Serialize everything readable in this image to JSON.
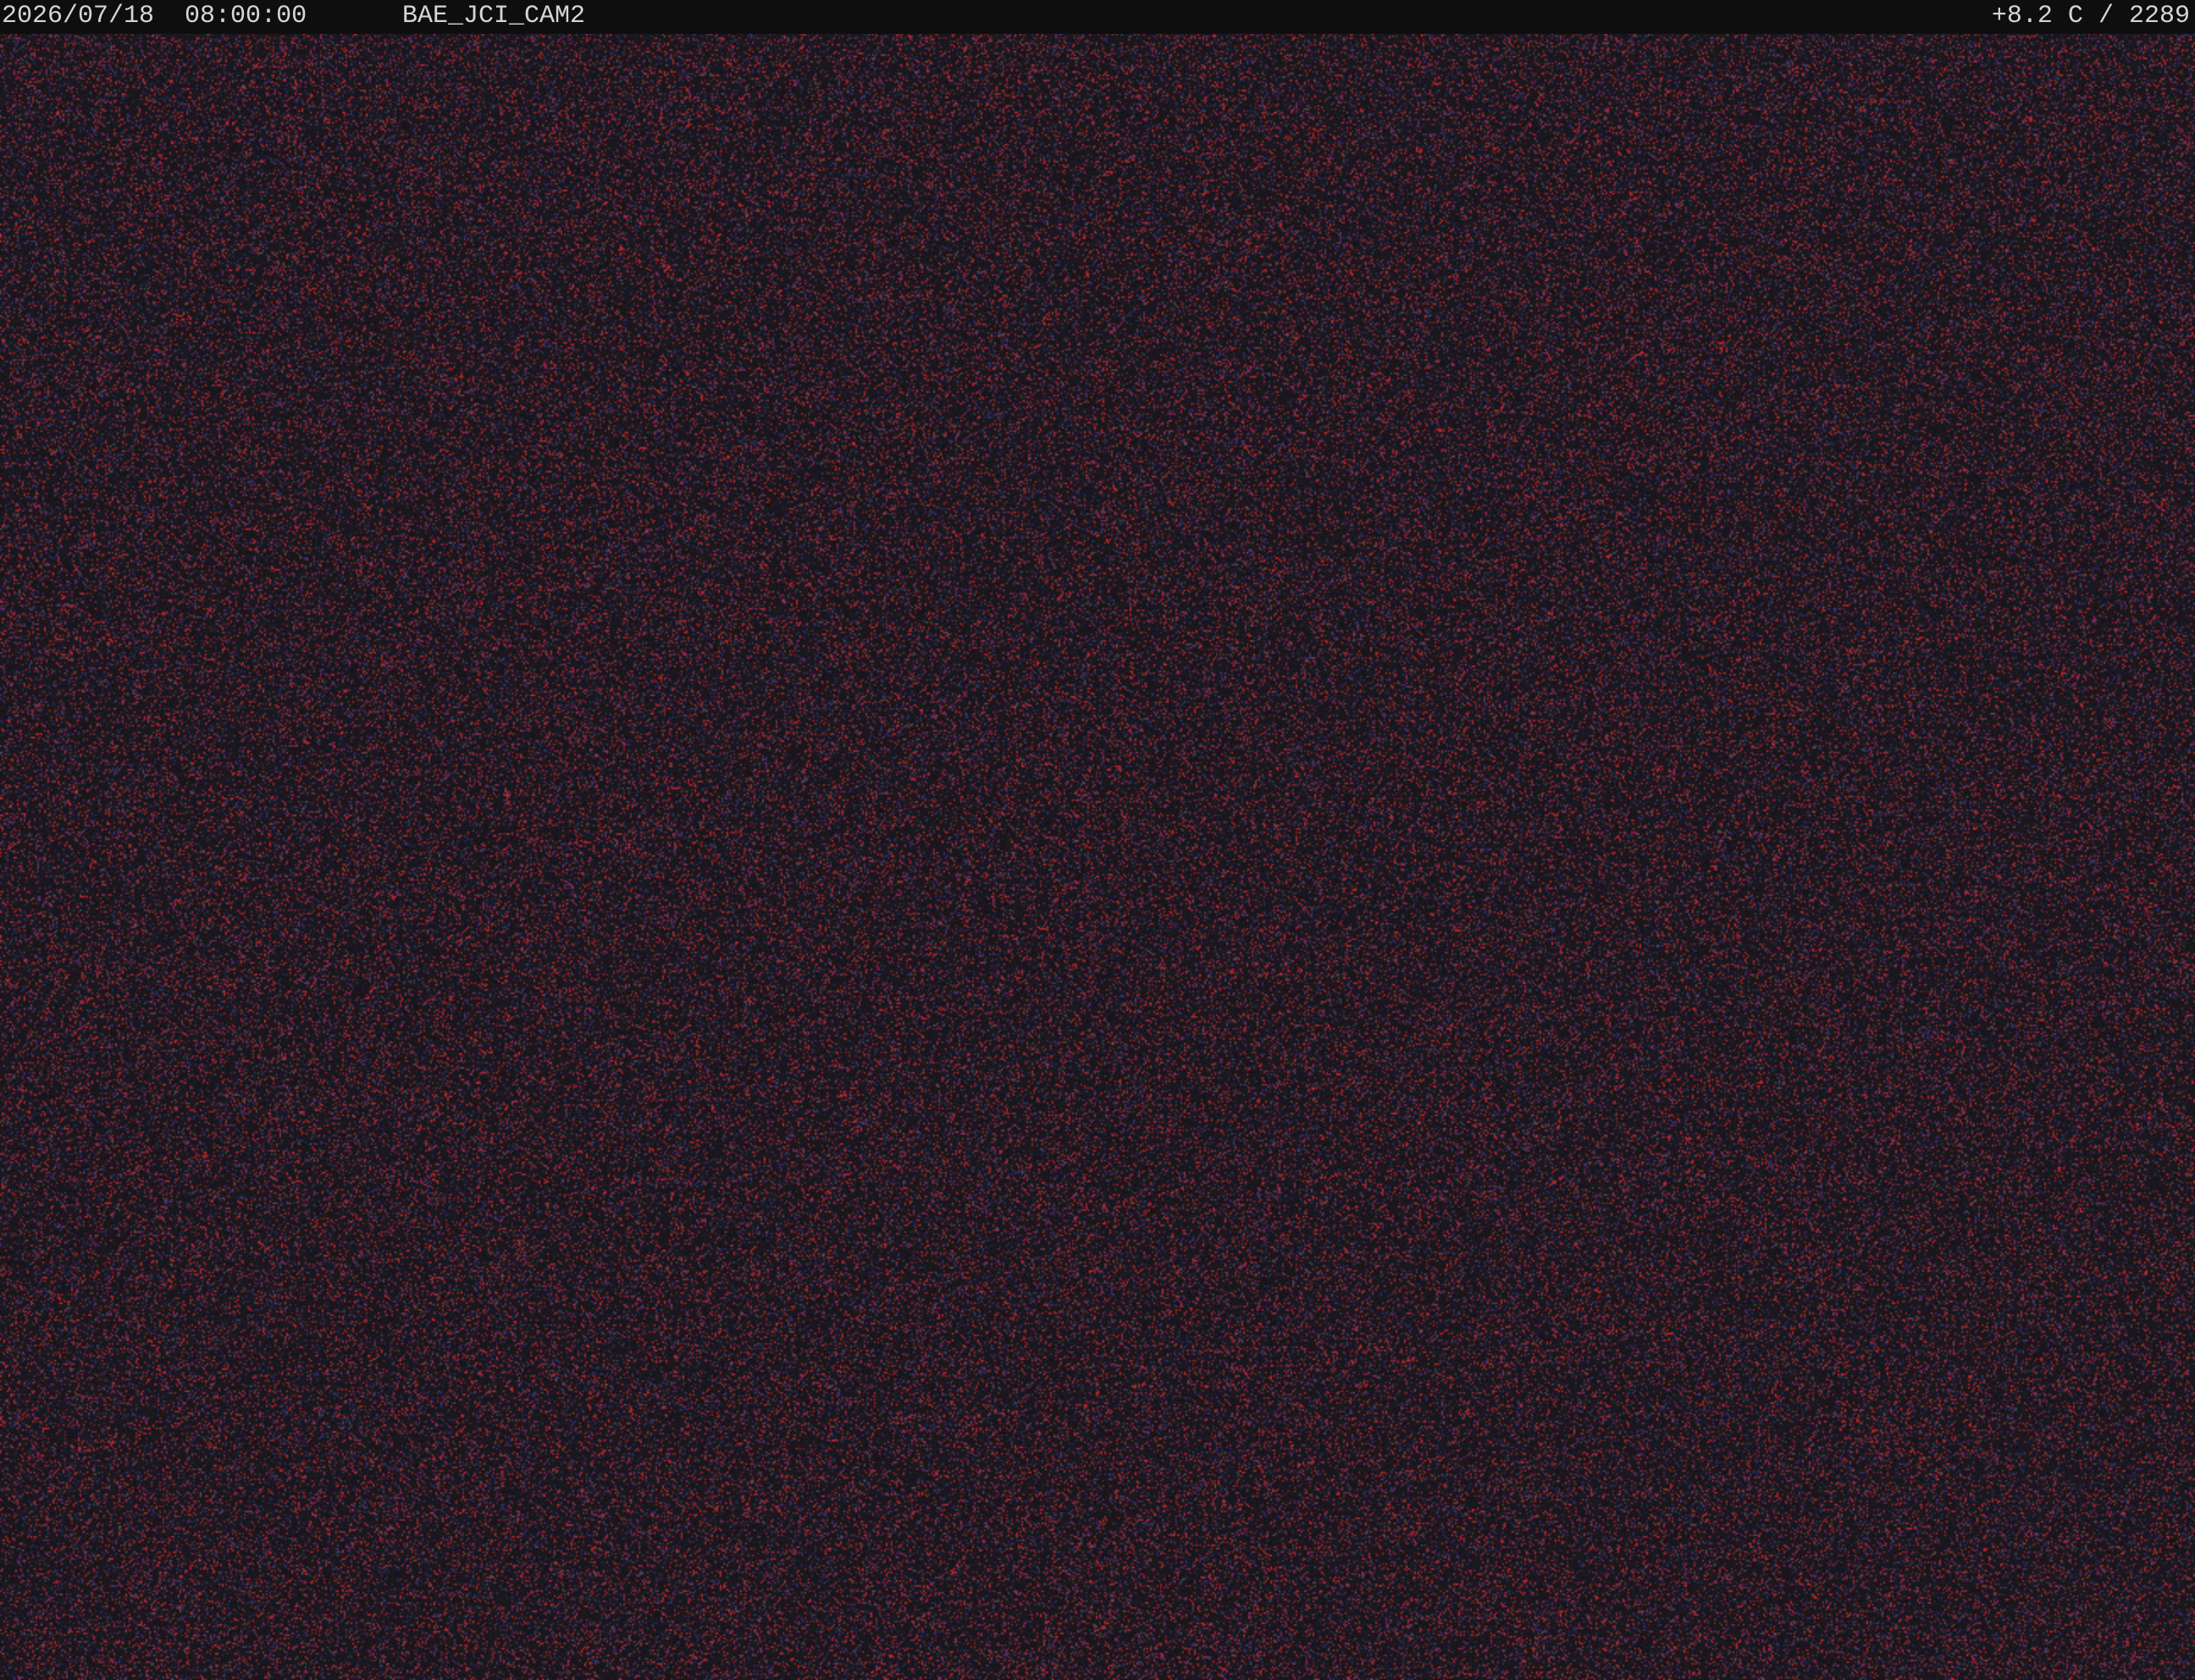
{
  "overlay": {
    "date": "2026/07/18",
    "time": "08:00:00",
    "camera_id": "BAE_JCI_CAM2",
    "temperature": "+8.2 C",
    "separator": "/",
    "counter": "2289"
  },
  "colors": {
    "overlay_bar": "#0e0e0e",
    "overlay_text": "#d6d6d6",
    "scene_base": "#1c191e",
    "noise_red": "#c0282a",
    "noise_blue": "#3a2f6a"
  }
}
